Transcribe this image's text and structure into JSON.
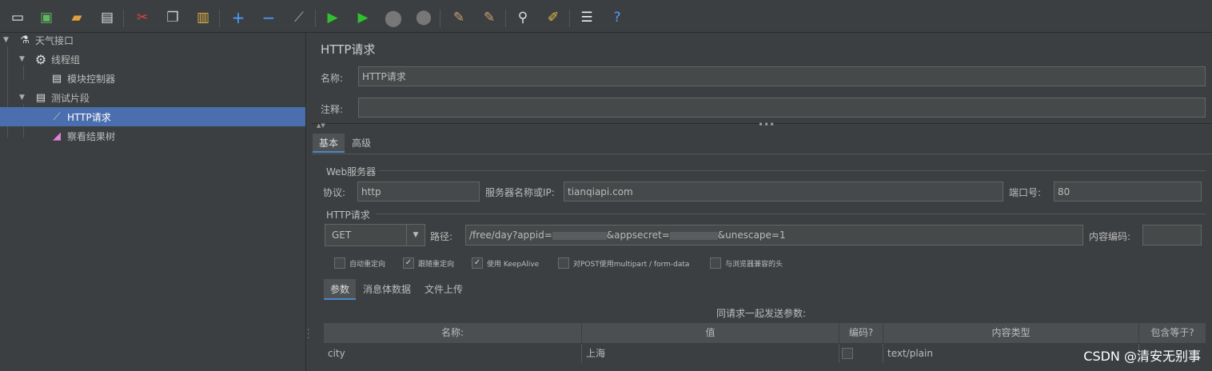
{
  "tree": {
    "items": [
      {
        "label": "天气接口",
        "icon": "test-plan-icon"
      },
      {
        "label": "线程组",
        "icon": "gear-icon"
      },
      {
        "label": "模块控制器",
        "icon": "module-controller-icon"
      },
      {
        "label": "测试片段",
        "icon": "test-fragment-icon"
      },
      {
        "label": "HTTP请求",
        "icon": "pipette-icon"
      },
      {
        "label": "察看结果树",
        "icon": "result-tree-icon"
      }
    ]
  },
  "panel": {
    "title": "HTTP请求",
    "name_label": "名称:",
    "name_value": "HTTP请求",
    "comment_label": "注释:",
    "comment_value": "",
    "tabs": [
      "基本",
      "高级"
    ],
    "web_server": {
      "section": "Web服务器",
      "protocol_label": "协议:",
      "protocol_value": "http",
      "server_label": "服务器名称或IP:",
      "server_value": "tianqiapi.com",
      "port_label": "端口号:",
      "port_value": "80"
    },
    "http_request": {
      "section": "HTTP请求",
      "method": "GET",
      "path_label": "路径:",
      "path_part1": "/free/day?appid=",
      "path_part2": "&appsecret=",
      "path_part3": "&unescape=1",
      "encoding_label": "内容编码:",
      "encoding_value": ""
    },
    "options": [
      {
        "label": "自动重定向",
        "checked": false
      },
      {
        "label": "跟随重定向",
        "checked": true
      },
      {
        "label": "使用 KeepAlive",
        "checked": true
      },
      {
        "label": "对POST使用multipart / form-data",
        "checked": false
      },
      {
        "label": "与浏览器兼容的头",
        "checked": false
      }
    ],
    "sub_tabs": [
      "参数",
      "消息体数据",
      "文件上传"
    ],
    "params": {
      "caption": "同请求一起发送参数:",
      "columns": [
        "名称:",
        "值",
        "编码?",
        "内容类型",
        "包含等于?"
      ],
      "rows": [
        {
          "name": "city",
          "value": "上海",
          "encode": false,
          "content_type": "text/plain"
        }
      ]
    }
  },
  "watermark": "CSDN @清安无别事",
  "colors": {
    "background": "#3c3f41",
    "selection": "#4b6eaf",
    "field": "#45494a",
    "text": "#bbbbbb"
  }
}
